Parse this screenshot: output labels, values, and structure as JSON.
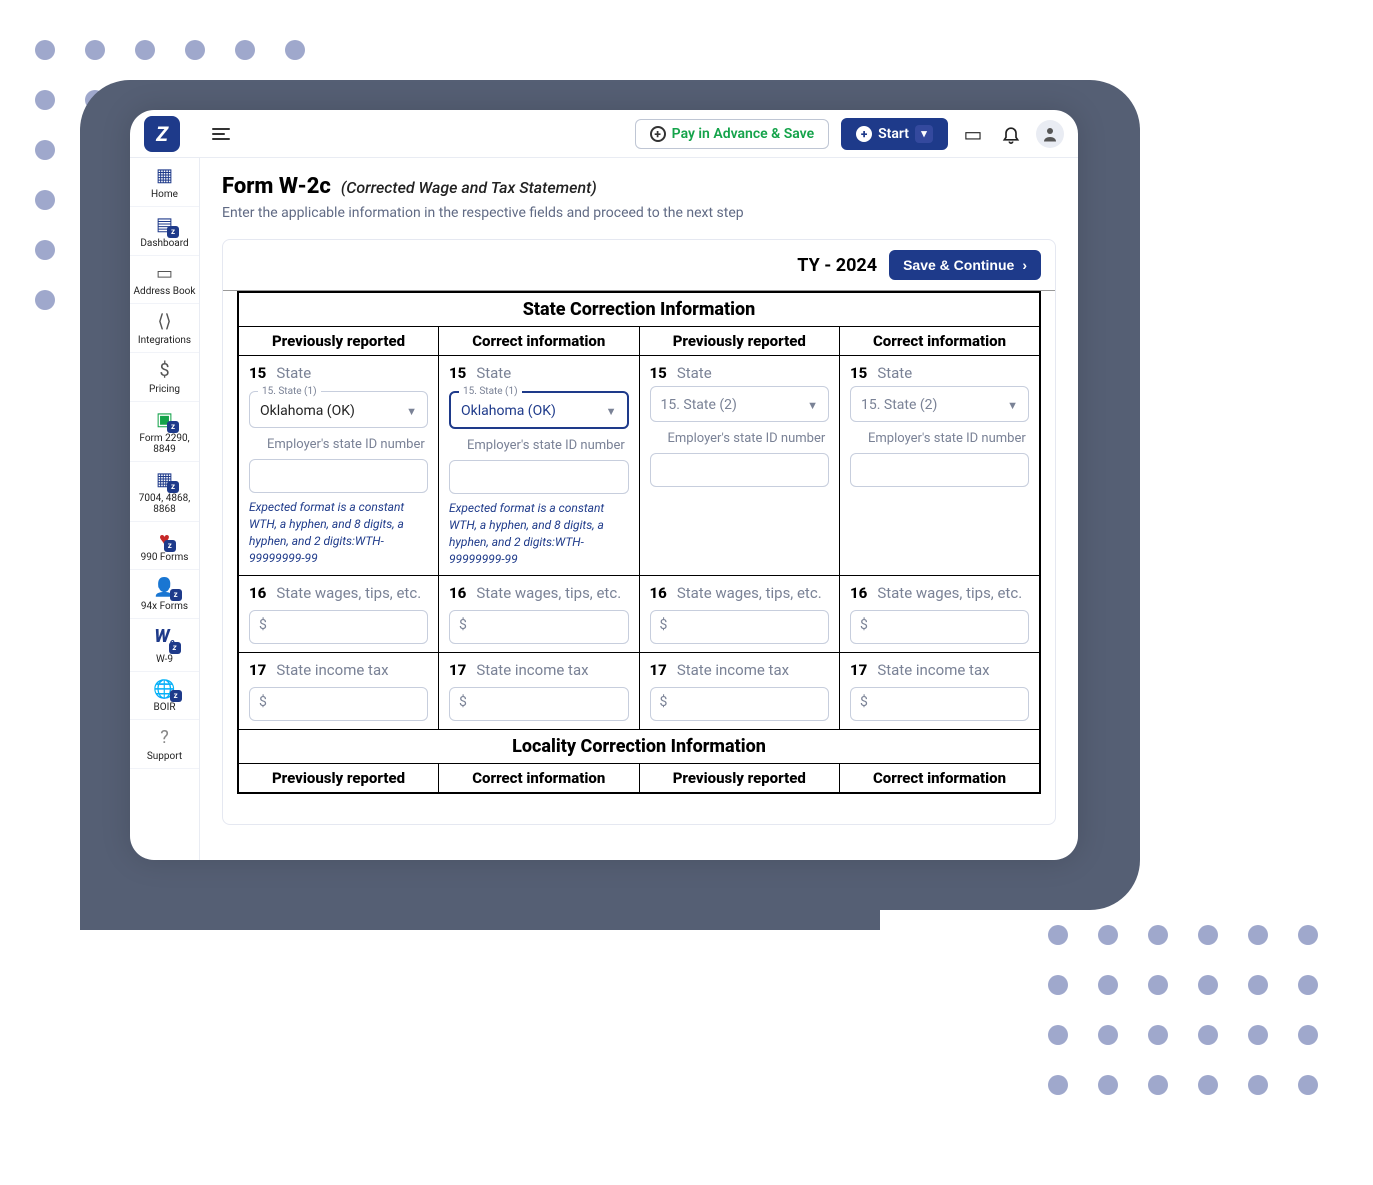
{
  "topbar": {
    "pay_advance": "Pay in Advance & Save",
    "start": "Start"
  },
  "sidebar": {
    "home": "Home",
    "dashboard": "Dashboard",
    "address_book": "Address Book",
    "integrations": "Integrations",
    "pricing": "Pricing",
    "form2290": "Form 2290, 8849",
    "f7004": "7004, 4868, 8868",
    "f990": "990 Forms",
    "f94x": "94x Forms",
    "w9": "W-9",
    "boir": "BOIR",
    "support": "Support"
  },
  "page": {
    "title": "Form W-2c",
    "subtitle": "(Corrected Wage and Tax Statement)",
    "desc": "Enter the applicable information in the respective fields and proceed to the next step",
    "ty": "TY - 2024",
    "save": "Save & Continue"
  },
  "section1": {
    "title": "State Correction Information",
    "col_prev": "Previously reported",
    "col_corr": "Correct information",
    "box15_num": "15",
    "box15_label": "State",
    "state1_legend": "15. State (1)",
    "state2_ph": "15. State (2)",
    "state_ok": "Oklahoma (OK)",
    "ein_label": "Employer's state ID number",
    "hint": "Expected format is a constant WTH, a hyphen, and 8 digits, a hyphen, and 2 digits:WTH-99999999-99",
    "box16_num": "16",
    "box16_label": "State wages, tips, etc.",
    "box17_num": "17",
    "box17_label": "State income tax",
    "dollar": "$"
  },
  "section2": {
    "title": "Locality Correction Information",
    "col_prev": "Previously reported",
    "col_corr": "Correct information"
  }
}
